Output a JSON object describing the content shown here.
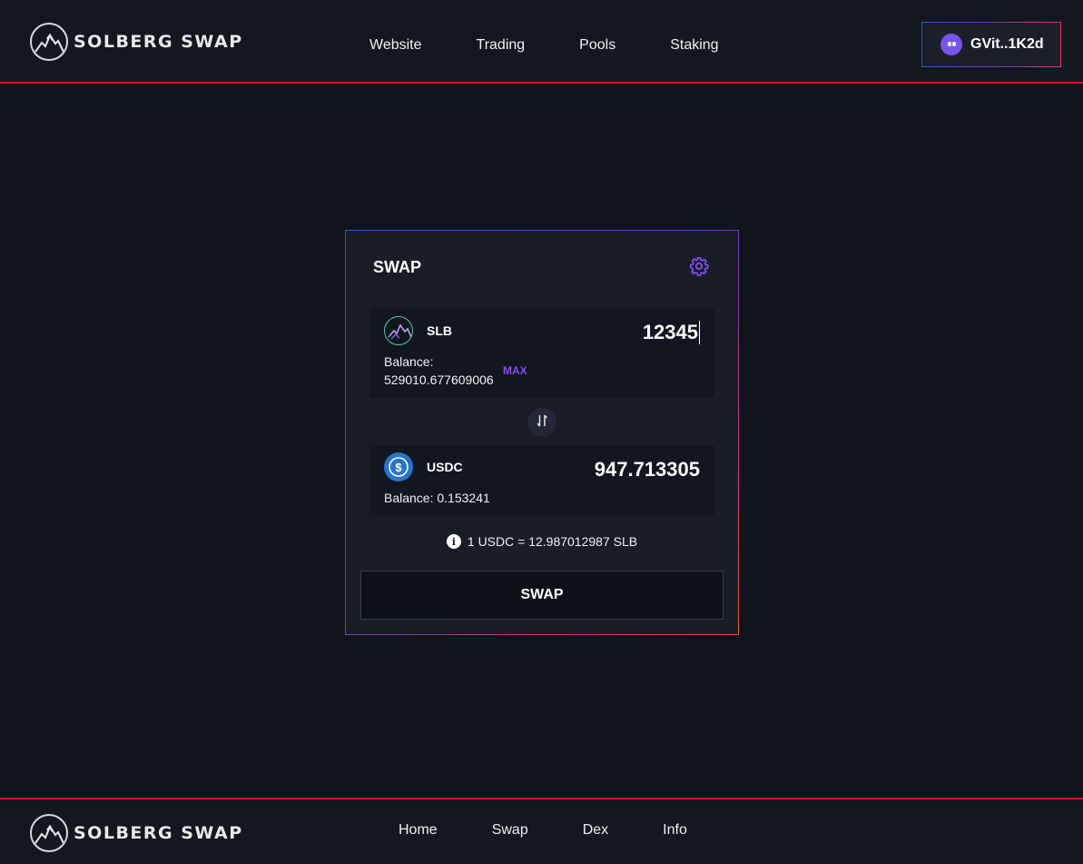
{
  "header": {
    "logo_text": "SOLBERG SWAP",
    "nav": [
      "Website",
      "Trading",
      "Pools",
      "Staking"
    ],
    "wallet_label": "GVit..1K2d"
  },
  "swap_card": {
    "title": "SWAP",
    "from": {
      "symbol": "SLB",
      "amount": "12345",
      "balance_label": "Balance:",
      "balance_value": "529010.677609006",
      "max_label": "MAX"
    },
    "to": {
      "symbol": "USDC",
      "amount": "947.713305",
      "balance_text": "Balance: 0.153241"
    },
    "rate_text": "1 USDC = 12.987012987 SLB",
    "swap_button": "SWAP"
  },
  "footer": {
    "logo_text": "SOLBERG SWAP",
    "nav": [
      "Home",
      "Swap",
      "Dex",
      "Info"
    ]
  },
  "colors": {
    "background": "#10141c",
    "header_border": "#d3171e",
    "accent_purple": "#8d4ef2",
    "usdc_blue": "#2775ca"
  },
  "icons": {
    "logo": "mountain-logo-icon",
    "settings": "gear-icon",
    "switch": "swap-arrows-icon",
    "info": "info-icon",
    "wallet": "phantom-ghost-icon"
  }
}
